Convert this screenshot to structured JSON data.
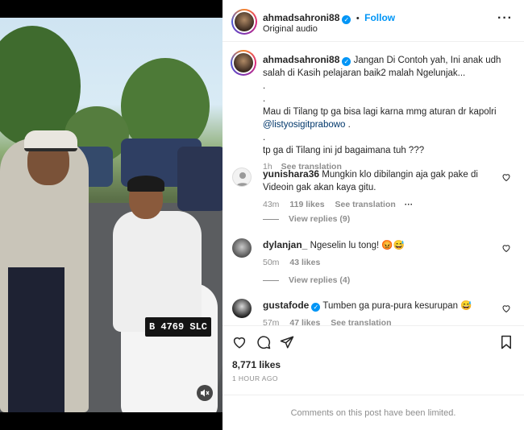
{
  "video": {
    "plate_text": "B 4769 SLC",
    "mute_icon": "speaker-muted-icon"
  },
  "header": {
    "username": "ahmadsahroni88",
    "follow_label": "Follow",
    "audio_label": "Original audio",
    "more_icon": "more-options-icon"
  },
  "caption": {
    "username": "ahmadsahroni88",
    "lines": [
      "Jangan Di Contoh yah, Ini anak udh salah di Kasih pelajaran baik2 malah Ngelunjak...",
      ".",
      ".",
      "Mau di Tilang tp ga bisa lagi karna mmg aturan dr kapolri",
      ".",
      ".",
      "tp ga di Tilang ini jd bagaimana tuh ???"
    ],
    "mention": "@listyosigitprabowo",
    "mention_suffix": " .",
    "time": "1h",
    "see_translation": "See translation"
  },
  "comments": [
    {
      "username": "yunishara36",
      "verified": false,
      "text": "Mungkin klo dibilangin aja gak pake di Videoin gak akan kaya gitu.",
      "time": "43m",
      "likes": "119 likes",
      "see_translation": "See translation",
      "more": "···",
      "replies": "View replies (9)"
    },
    {
      "username": "dylanjan_",
      "verified": false,
      "text": "Ngeselin lu tong! 😡😅",
      "time": "50m",
      "likes": "43 likes",
      "replies": "View replies (4)"
    },
    {
      "username": "gustafode",
      "verified": true,
      "text": "Tumben ga pura-pura kesurupan 😅",
      "time": "57m",
      "likes": "47 likes",
      "see_translation": "See translation"
    }
  ],
  "footer": {
    "likes": "8,771 likes",
    "time_ago": "1 HOUR AGO",
    "limited": "Comments on this post have been limited."
  },
  "colors": {
    "accent": "#0095f6",
    "mention": "#00376b",
    "muted": "#8e8e8e"
  }
}
